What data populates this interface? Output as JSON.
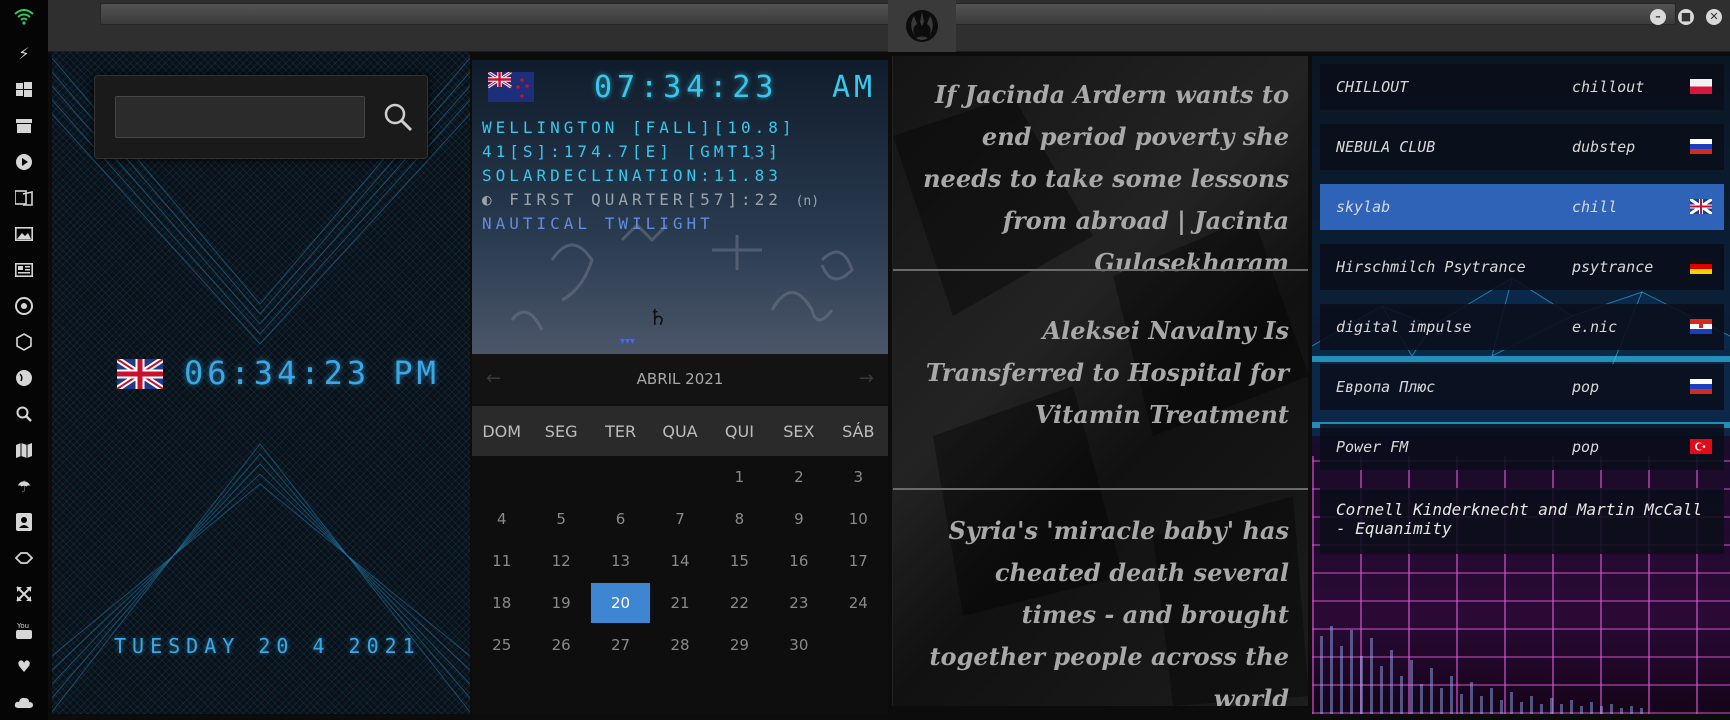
{
  "sidebar": {
    "icons": [
      "wifi-icon",
      "lightning-icon",
      "windows-icon",
      "archive-icon",
      "play-icon",
      "translate-icon",
      "image-icon",
      "news-icon",
      "settings-icon",
      "hexagon-icon",
      "globe-icon",
      "search-icon",
      "map-icon",
      "umbrella-icon",
      "contacts-icon",
      "tag-icon",
      "expand-icon",
      "youtube-icon",
      "heart-icon",
      "cloud-icon"
    ]
  },
  "topbar": {
    "logo": "rebel-alliance-logo"
  },
  "left_clock": {
    "search": {
      "value": "",
      "placeholder": ""
    },
    "time": "06:34:23 PM",
    "date": "TUESDAY 20 4 2021",
    "flag": "united-kingdom"
  },
  "nz_panel": {
    "flag": "new-zealand",
    "time": "07:34:23",
    "ampm": "AM",
    "location": "WELLINGTON [FALL][10.8]",
    "coords": "41[S]:174.7[E] [GMT13]",
    "solar": "SOLARDECLINATION:11.83",
    "moon_phase": "FIRST QUARTER[57]:22",
    "moon_suffix": "(n)",
    "twilight": "NAUTICAL TWILIGHT",
    "planet_symbol": "♄",
    "marker": "▾▾▾"
  },
  "calendar": {
    "month": "ABRIL 2021",
    "prev": "←",
    "next": "→",
    "days": [
      "DOM",
      "SEG",
      "TER",
      "QUA",
      "QUI",
      "SEX",
      "SÁB"
    ],
    "weeks": [
      [
        "",
        "",
        "",
        "",
        "1",
        "2",
        "3"
      ],
      [
        "4",
        "5",
        "6",
        "7",
        "8",
        "9",
        "10"
      ],
      [
        "11",
        "12",
        "13",
        "14",
        "15",
        "16",
        "17"
      ],
      [
        "18",
        "19",
        "20",
        "21",
        "22",
        "23",
        "24"
      ],
      [
        "25",
        "26",
        "27",
        "28",
        "29",
        "30",
        ""
      ]
    ],
    "today": "20"
  },
  "news": [
    {
      "title": "If Jacinda Ardern wants to end period poverty she needs to take some lessons from abroad | Jacinta Gulasekharam"
    },
    {
      "title": "Aleksei Navalny Is Transferred to Hospital for Vitamin Treatment"
    },
    {
      "title": "Syria's 'miracle baby' has cheated death several times - and brought together people across the world"
    }
  ],
  "radio": {
    "stations": [
      {
        "name": "CHILLOUT",
        "genre": "chillout",
        "flag": "poland",
        "selected": false
      },
      {
        "name": "NEBULA CLUB",
        "genre": "dubstep",
        "flag": "russia",
        "selected": false
      },
      {
        "name": "skylab",
        "genre": "chill",
        "flag": "united-kingdom",
        "selected": true
      },
      {
        "name": "Hirschmilch Psytrance",
        "genre": "psytrance",
        "flag": "germany",
        "selected": false
      },
      {
        "name": "digital impulse",
        "genre": "e.nic",
        "flag": "croatia",
        "selected": false
      },
      {
        "name": "Европа Плюс",
        "genre": "pop",
        "flag": "russia",
        "selected": false
      },
      {
        "name": "Power FM",
        "genre": "pop",
        "flag": "turkey",
        "selected": false
      }
    ],
    "now_playing": "Cornell Kinderknecht and Martin McCall - Equanimity"
  }
}
